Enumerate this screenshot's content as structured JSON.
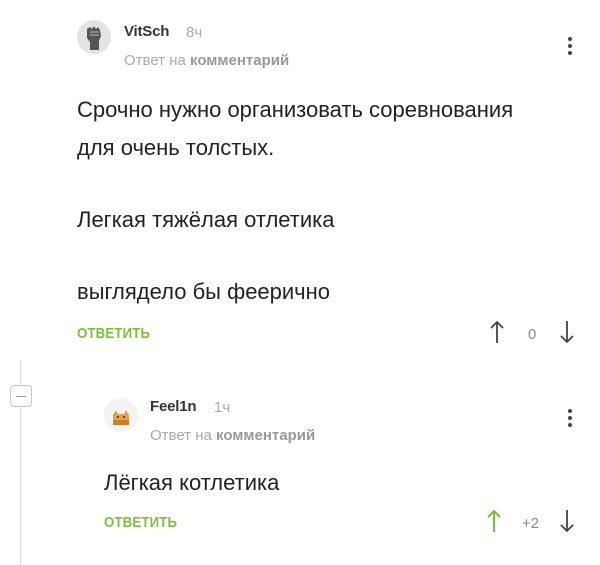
{
  "comments": [
    {
      "username": "VitSch",
      "time": "8ч",
      "reply_prefix": "Ответ на",
      "reply_link": "комментарий",
      "lines": [
        "Срочно нужно организовать соревнования",
        "для очень толстых.",
        "Легкая тяжёлая отлетика",
        "выглядело бы феерично"
      ],
      "reply_label": "ОТВЕТИТЬ",
      "score": "0"
    },
    {
      "username": "Feel1n",
      "time": "1ч",
      "reply_prefix": "Ответ на",
      "reply_link": "комментарий",
      "lines": [
        "Лёгкая котлетика"
      ],
      "reply_label": "ОТВЕТИТЬ",
      "score": "+2"
    }
  ],
  "colors": {
    "reply_button": "#7cbf3b",
    "upvote_active": "#7cbf3b",
    "text": "#222222",
    "muted": "#aaaaaa"
  },
  "icons": {
    "avatar_1": "raised-fist-avatar",
    "avatar_2": "cat-avatar",
    "menu": "vertical-dots-icon",
    "upvote": "arrow-up-icon",
    "downvote": "arrow-down-icon",
    "collapse": "minus-icon"
  }
}
